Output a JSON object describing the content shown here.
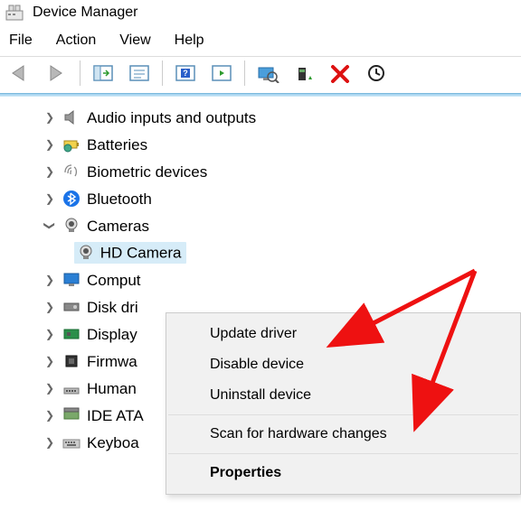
{
  "window": {
    "title": "Device Manager"
  },
  "menus": {
    "file": "File",
    "action": "Action",
    "view": "View",
    "help": "Help"
  },
  "tree": {
    "audio": "Audio inputs and outputs",
    "batteries": "Batteries",
    "biometric": "Biometric devices",
    "bluetooth": "Bluetooth",
    "cameras": "Cameras",
    "hd_camera": "HD Camera",
    "computers": "Comput",
    "disk": "Disk dri",
    "display": "Display",
    "firmware": "Firmwa",
    "human": "Human",
    "ide": "IDE ATA",
    "keyboard": "Keyboa"
  },
  "context_menu": {
    "update": "Update driver",
    "disable": "Disable device",
    "uninstall": "Uninstall device",
    "scan": "Scan for hardware changes",
    "properties": "Properties"
  }
}
